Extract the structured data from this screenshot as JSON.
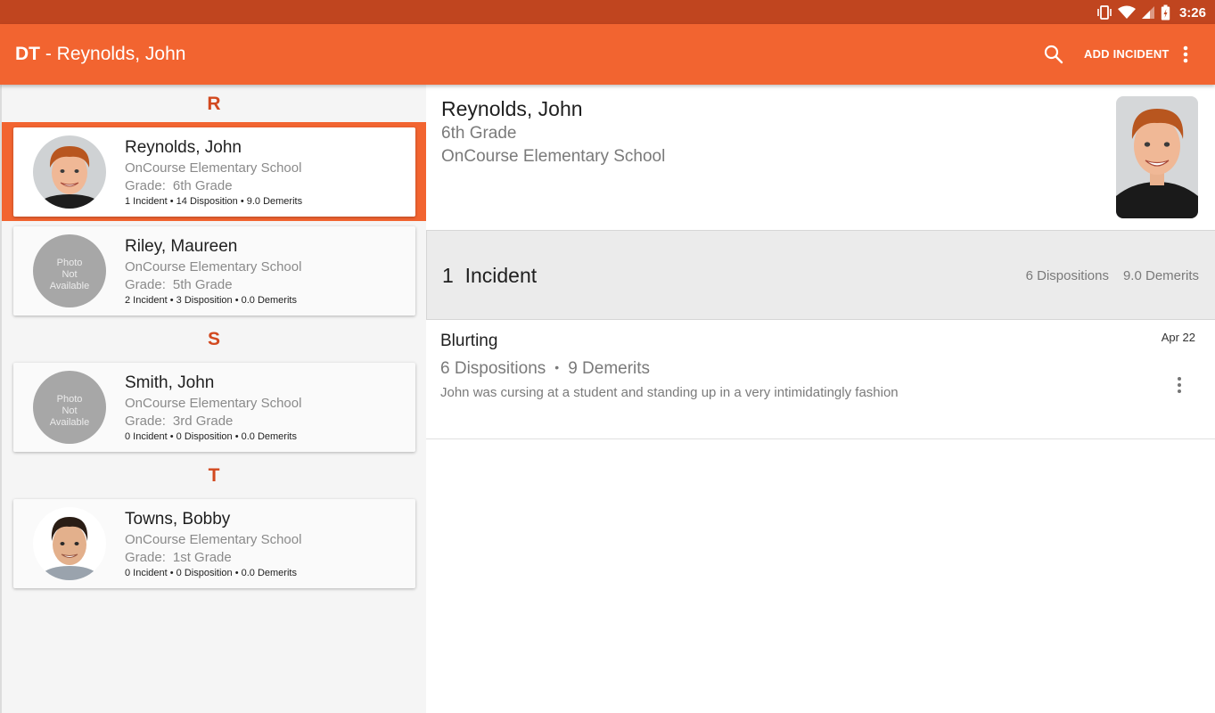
{
  "status_bar": {
    "time": "3:26",
    "icons": [
      "vibrate-icon",
      "wifi-icon",
      "signal-icon",
      "battery-icon"
    ]
  },
  "app_bar": {
    "title_prefix": "DT",
    "title_sep": " - ",
    "title_name": "Reynolds, John",
    "add_incident_label": "ADD INCIDENT",
    "icons": [
      "search-icon",
      "more-vert-icon"
    ]
  },
  "student_list": {
    "sections": [
      {
        "letter": "R",
        "students": [
          {
            "name": "Reynolds, John",
            "school": "OnCourse Elementary School",
            "grade_label": "Grade:",
            "grade": "6th Grade",
            "stats": "1 Incident • 14 Disposition • 9.0 Demerits",
            "selected": true,
            "photo": "boy-red-hair"
          },
          {
            "name": "Riley, Maureen",
            "school": "OnCourse Elementary School",
            "grade_label": "Grade:",
            "grade": "5th Grade",
            "stats": "2 Incident • 3 Disposition • 0.0 Demerits",
            "photo_placeholder": [
              "Photo",
              "Not",
              "Available"
            ]
          }
        ]
      },
      {
        "letter": "S",
        "students": [
          {
            "name": "Smith, John",
            "school": "OnCourse Elementary School",
            "grade_label": "Grade:",
            "grade": "3rd Grade",
            "stats": "0 Incident • 0 Disposition • 0.0 Demerits",
            "photo_placeholder": [
              "Photo",
              "Not",
              "Available"
            ]
          }
        ]
      },
      {
        "letter": "T",
        "students": [
          {
            "name": "Towns, Bobby",
            "school": "OnCourse Elementary School",
            "grade_label": "Grade:",
            "grade": "1st Grade",
            "stats": "0 Incident • 0 Disposition • 0.0 Demerits",
            "photo": "boy-dark-hair"
          }
        ]
      }
    ]
  },
  "detail": {
    "name": "Reynolds, John",
    "grade": "6th Grade",
    "school": "OnCourse Elementary School",
    "summary": {
      "incident_count": "1",
      "incident_label": "Incident",
      "dispositions": "6 Dispositions",
      "demerits": "9.0 Demerits"
    },
    "incidents": [
      {
        "title": "Blurting",
        "date": "Apr 22",
        "dispositions": "6 Dispositions",
        "separator": "•",
        "demerits": "9 Demerits",
        "description": "John was cursing at a student and standing up in a very intimidatingly fashion"
      }
    ]
  },
  "colors": {
    "status_bar": "#c0451f",
    "app_bar": "#f26430",
    "section_letter": "#d2491f",
    "selected_band": "#f26430"
  }
}
